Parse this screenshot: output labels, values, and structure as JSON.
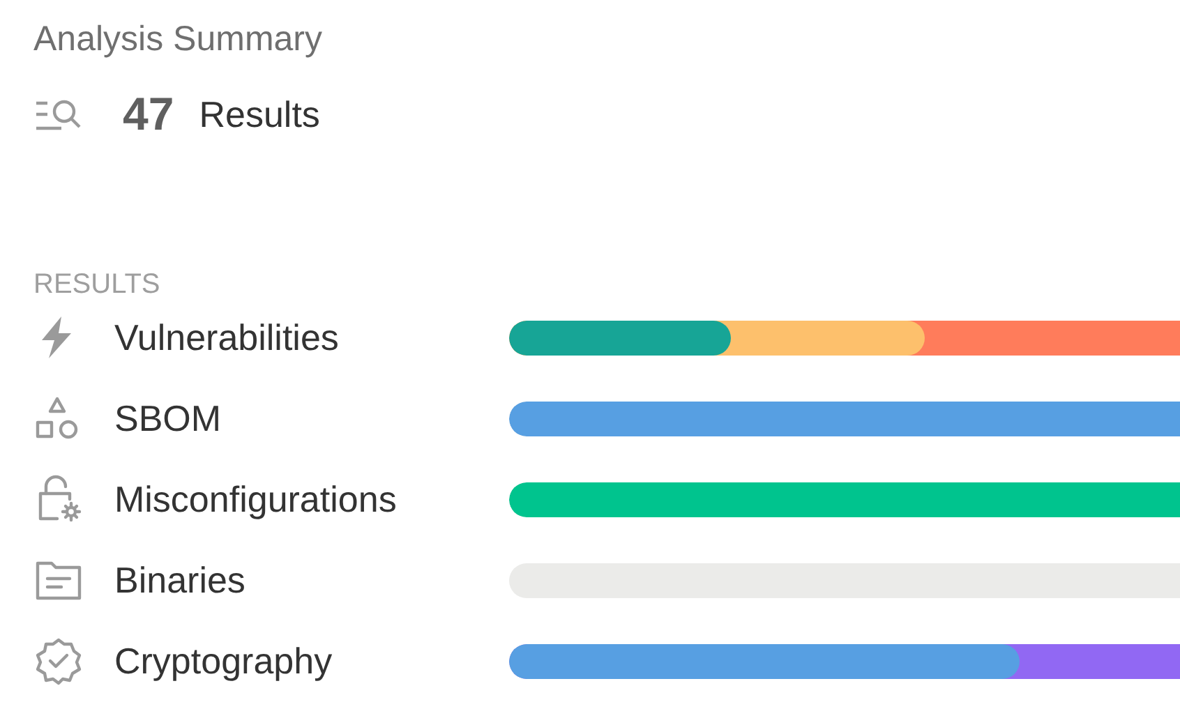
{
  "title": "Analysis Summary",
  "summary": {
    "count": "47",
    "label": "Results"
  },
  "section_label": "RESULTS",
  "results": [
    {
      "label": "Vulnerabilities",
      "kind": "lightning",
      "segments": [
        {
          "color": "#17a596",
          "level": 0.33
        },
        {
          "color": "#fdc06c",
          "level": 0.62
        },
        {
          "color": "#ff7c5b",
          "level": 1
        }
      ]
    },
    {
      "label": "SBOM",
      "kind": "shapes",
      "segments": [
        {
          "color": "#579fe2",
          "level": 1
        }
      ]
    },
    {
      "label": "Misconfigurations",
      "kind": "lock-gear",
      "segments": [
        {
          "color": "#00c48e",
          "level": 1
        }
      ]
    },
    {
      "label": "Binaries",
      "kind": "folder"
    },
    {
      "label": "Cryptography",
      "kind": "badge-check",
      "segments": [
        {
          "color": "#579fe2",
          "level": 0.76
        },
        {
          "color": "#9168f3",
          "level": 1
        }
      ]
    }
  ]
}
